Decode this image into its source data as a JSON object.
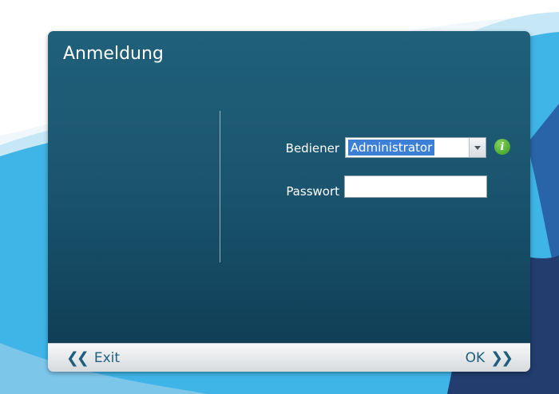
{
  "dialog": {
    "title": "Anmeldung",
    "user_label": "Bediener",
    "user_value": "Administrator",
    "password_label": "Passwort",
    "password_value": "",
    "info_glyph": "i"
  },
  "footer": {
    "exit_label": "Exit",
    "ok_label": "OK"
  },
  "icons": {
    "exit": "double-chevron-left-icon",
    "ok": "double-chevron-right-icon",
    "dropdown": "caret-down-icon",
    "info": "info-icon"
  },
  "colors": {
    "panel_top": "#20607a",
    "panel_bottom": "#103f57",
    "selection": "#3b7fd6",
    "info_green": "#3d9a22",
    "footer_text": "#1f5f7d"
  }
}
